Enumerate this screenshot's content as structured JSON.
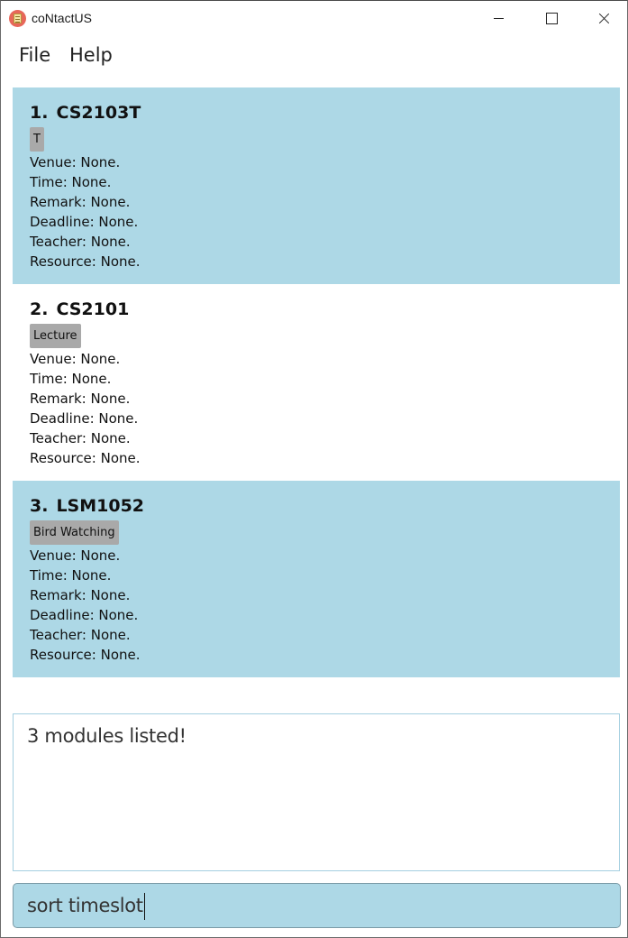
{
  "window": {
    "title": "coNtactUS"
  },
  "menu": {
    "file": "File",
    "help": "Help"
  },
  "modules": [
    {
      "index": "1.",
      "code": "CS2103T",
      "tag": "T",
      "venue": "Venue: None.",
      "time": "Time: None.",
      "remark": "Remark: None.",
      "deadline": "Deadline: None.",
      "teacher": "Teacher: None.",
      "resource": "Resource: None."
    },
    {
      "index": "2.",
      "code": "CS2101",
      "tag": "Lecture",
      "venue": "Venue: None.",
      "time": "Time: None.",
      "remark": "Remark: None.",
      "deadline": "Deadline: None.",
      "teacher": "Teacher: None.",
      "resource": "Resource: None."
    },
    {
      "index": "3.",
      "code": "LSM1052",
      "tag": "Bird Watching",
      "venue": "Venue: None.",
      "time": "Time: None.",
      "remark": "Remark: None.",
      "deadline": "Deadline: None.",
      "teacher": "Teacher: None.",
      "resource": "Resource: None."
    }
  ],
  "result": {
    "text": "3 modules listed!"
  },
  "command": {
    "value": "sort timeslot"
  },
  "colors": {
    "card_shaded": "#add8e6",
    "tag": "#a9a9a9",
    "command_bg": "#add8e6"
  },
  "icons": {
    "app": "spreadsheet-app-icon"
  }
}
